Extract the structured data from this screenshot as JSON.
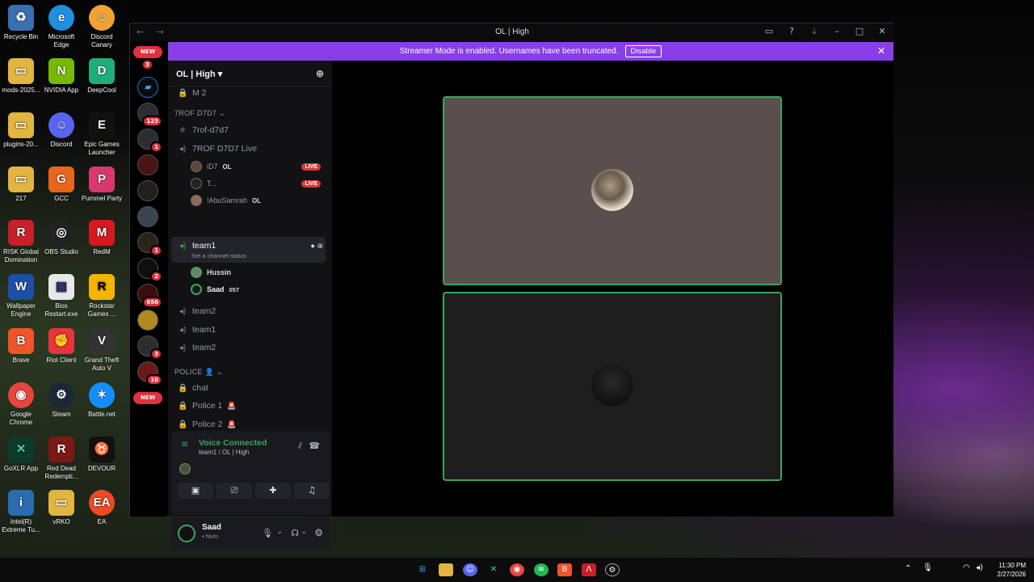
{
  "desktop": {
    "icons": [
      {
        "label": "Recycle Bin"
      },
      {
        "label": "Microsoft Edge"
      },
      {
        "label": "Discord Canary"
      },
      {
        "label": "mods-2025..."
      },
      {
        "label": "NVIDIA App"
      },
      {
        "label": "DeepCool"
      },
      {
        "label": "plugins-20..."
      },
      {
        "label": "Discord"
      },
      {
        "label": "Epic Games Launcher"
      },
      {
        "label": "217"
      },
      {
        "label": "GCC"
      },
      {
        "label": "Pummel Party"
      },
      {
        "label": "RISK Global Domination"
      },
      {
        "label": "OBS Studio"
      },
      {
        "label": "RedM"
      },
      {
        "label": "Wallpaper Engine"
      },
      {
        "label": "Bios Restart.exe"
      },
      {
        "label": "Rockstar Games ..."
      },
      {
        "label": "Brave"
      },
      {
        "label": "Riot Client"
      },
      {
        "label": "Grand Theft Auto V"
      },
      {
        "label": "Google Chrome"
      },
      {
        "label": "Steam"
      },
      {
        "label": "Battle.net"
      },
      {
        "label": "GoXLR App"
      },
      {
        "label": "Red Dead Redempti..."
      },
      {
        "label": "DEVOUR"
      },
      {
        "label": "Intel(R) Extreme Tu..."
      },
      {
        "label": "vRKO"
      },
      {
        "label": "EA"
      }
    ]
  },
  "window": {
    "title": "OL | High",
    "nav": "← →"
  },
  "banner": {
    "text": "Streamer Mode is enabled. Usernames have been truncated.",
    "button": "Disable"
  },
  "rail": {
    "new_top": "NEW",
    "new_bottom": "NEW",
    "badges": [
      "3",
      "125",
      "1",
      "1",
      "2",
      "656",
      "3",
      "10"
    ]
  },
  "sidebar": {
    "guild_name": "OL | High",
    "channels_top": [
      {
        "name": "M 2"
      }
    ],
    "category1": "7ROF D7D7",
    "ch_text1": "7rof-d7d7",
    "ch_voice_live": "7ROF D7D7 Live",
    "live_users": [
      {
        "name": "iD7",
        "tag": "OL",
        "live": "LIVE"
      },
      {
        "name": "T...",
        "tag": "",
        "live": "LIVE"
      },
      {
        "name": "!AbuSamrah",
        "tag": "OL",
        "live": ""
      }
    ],
    "active_channel": "team1",
    "active_status": "Set a channel status",
    "voice_users": [
      {
        "name": "Hussin",
        "tag": ""
      },
      {
        "name": "Saad",
        "tag": "057"
      }
    ],
    "more_voice": [
      {
        "name": "team2"
      },
      {
        "name": "team1"
      },
      {
        "name": "team2"
      }
    ],
    "category2": "POLICE",
    "police_channels": [
      {
        "name": "chat"
      },
      {
        "name": "Police 1"
      },
      {
        "name": "Police 2"
      }
    ]
  },
  "voice": {
    "status": "Voice Connected",
    "channel": "team1 / OL | High"
  },
  "user": {
    "name": "Saad",
    "status": "• Nvm"
  },
  "taskbar": {
    "time": "11:30 PM",
    "date": "2/27/2026"
  },
  "colors": {
    "banner": "#8a3ee8",
    "voice_green": "#3ba55c",
    "live_red": "#da373c",
    "tile_bg_1": "#5b4f4e",
    "tile_bg_2": "#1e1e1e"
  }
}
